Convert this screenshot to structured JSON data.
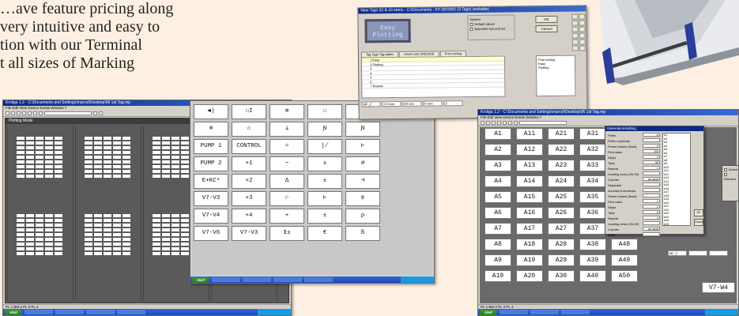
{
  "intro": {
    "lines": [
      "…ave feature pricing along",
      "very intuitive and easy to",
      "tion with our Terminal",
      "t all sizes of Marking"
    ]
  },
  "taskbar": {
    "start": "start"
  },
  "win_plot": {
    "title": "Kroliga 1.2 - C:\\Documents and Settings\\marcel\\Desktop\\06 1st Tag.mp",
    "menu": "File  Edit  View  Device  Extras  Window  ?",
    "mode_label": "Plotting Mode",
    "status": "PL 1  BM 2  PL 3  PL 4"
  },
  "win_keypad": {
    "keys": [
      "◄)",
      "☐I",
      "⊕",
      "☐",
      "⊕",
      "⊗",
      "⌂",
      "⊥",
      "Ɲ",
      "Ɲ",
      "PUMP 1",
      "CONTROL",
      "≈",
      "∤",
      "⊢",
      "PUMP 2",
      "+1",
      "∼",
      "±",
      "⌀",
      "E+KC²",
      "+2",
      "Δ",
      "±",
      "⊣",
      "V7-V3",
      "+3",
      "⚐",
      "⊢",
      "¢",
      "V7-V4",
      "+4",
      "+",
      "±",
      "ρ",
      "V7-V6",
      "V7-V3",
      "Ɨ±",
      "€",
      "ƃ"
    ]
  },
  "win_editor": {
    "title": "New Tags 62 & 43 items - C:\\Documents - KT-DES001  (3 Tags)  (editable)",
    "lcd_line1": "Easy",
    "lcd_line2": "Plotting",
    "tabs": [
      "Tag  Tags  Tag-tables",
      "Insert  Line  UNICODE",
      "Print sorting"
    ],
    "lines": [
      "1  Easy",
      "2  Plotting",
      "3",
      "4",
      "5",
      "6",
      "7  Repeat"
    ],
    "options_title": "Options",
    "options": [
      "Default values",
      "Extended text end set"
    ],
    "btn_ok": "OK",
    "btn_cancel": "Cancel",
    "preview_title": "Print sorting",
    "preview_lines": [
      "Easy",
      "Plotting"
    ],
    "bottom_fields": [
      "MF_2",
      "2.0 mm",
      "30 mm",
      "0 mm",
      "3"
    ]
  },
  "win_tags": {
    "title": "Kroliga 1.2 - C:\\Documents and Settings\\marcel\\Desktop\\06 1st Tag.mp",
    "tags": [
      "A1",
      "A11",
      "A21",
      "A31",
      "",
      "A2",
      "A12",
      "A22",
      "A32",
      "",
      "A3",
      "A13",
      "A23",
      "A33",
      "",
      "A4",
      "A14",
      "A24",
      "A34",
      "",
      "A5",
      "A15",
      "A25",
      "A35",
      "",
      "A6",
      "A16",
      "A26",
      "A36",
      "",
      "A7",
      "A17",
      "A27",
      "A37",
      "",
      "A8",
      "A18",
      "A28",
      "A38",
      "A48",
      "A9",
      "A19",
      "A29",
      "A39",
      "A49",
      "A10",
      "A20",
      "A30",
      "A40",
      "A50"
    ],
    "tag_v": "V7-W4",
    "dialog_title": "Generation/editing",
    "fields": [
      {
        "label": "Prefix",
        "value": "A"
      },
      {
        "label": "Prefix numerals",
        "value": ""
      },
      {
        "label": "Preset values (fixed)",
        "value": "0"
      },
      {
        "label": "First value",
        "value": "100"
      },
      {
        "label": "Steps",
        "value": "1"
      },
      {
        "label": "Total",
        "value": "50"
      },
      {
        "label": "Repeat",
        "value": "1"
      },
      {
        "label": "Leading zeros (00-00)",
        "value": ""
      },
      {
        "label": "Counter",
        "value": "as usual"
      },
      {
        "label": "Separator",
        "value": ""
      },
      {
        "label": "Increment numerals",
        "value": ""
      },
      {
        "label": "Preset values (fixed)",
        "value": ""
      },
      {
        "label": "First value",
        "value": "1"
      },
      {
        "label": "Steps",
        "value": "1"
      },
      {
        "label": "Total",
        "value": "5"
      },
      {
        "label": "Repeat",
        "value": "1"
      },
      {
        "label": "Leading zeros (00-00)",
        "value": ""
      },
      {
        "label": "Counter",
        "value": "as usual"
      },
      {
        "label": "Suffix",
        "value": ""
      }
    ],
    "list": [
      "A1",
      "A2",
      "A3",
      "A4",
      "A5",
      "A6",
      "A7",
      "A8",
      "A9",
      "A10",
      "A11",
      "A12",
      "A13",
      "A14",
      "A15",
      "A16",
      "A17",
      "A18",
      "A19",
      "A20",
      "A21",
      "A22",
      "A23",
      "A24",
      "A25",
      "A26"
    ],
    "btn_ok": "OK",
    "btn_cancel": "Cancel",
    "side_options": [
      "Default",
      "Extended"
    ],
    "bottom_field": "MF_2",
    "status": "PL 1  BM 2  PL 3  PL 4"
  }
}
